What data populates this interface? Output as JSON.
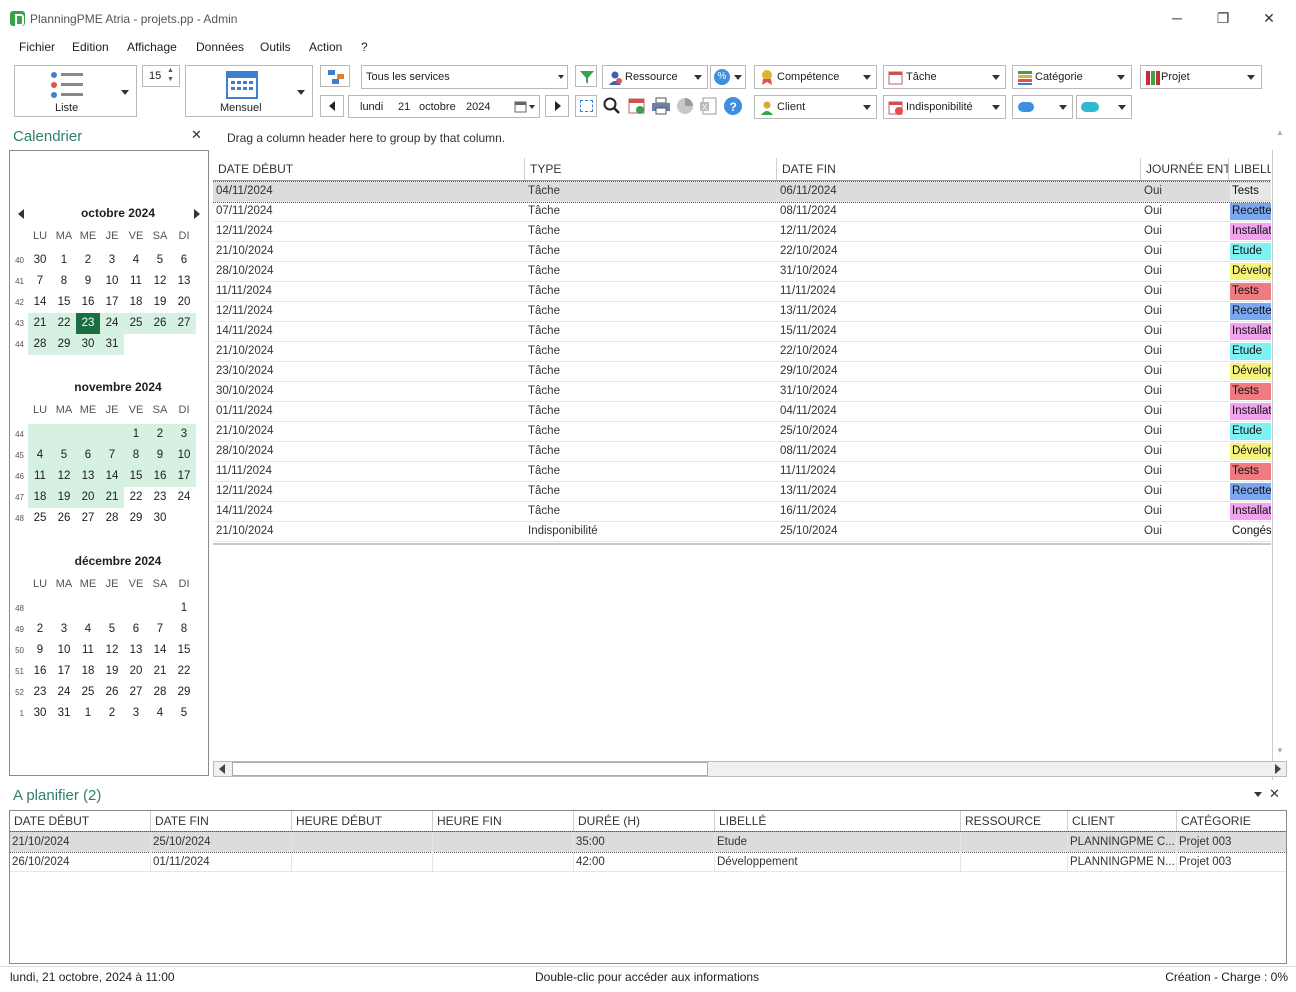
{
  "window": {
    "title": "PlanningPME Atria - projets.pp - Admin",
    "minimize": "─",
    "maximize": "❐",
    "close": "✕"
  },
  "menu": [
    "Fichier",
    "Edition",
    "Affichage",
    "Données",
    "Outils",
    "Action",
    "?"
  ],
  "toolbar": {
    "view_list_label": "Liste",
    "spin_value": "15",
    "view_month_label": "Mensuel",
    "services": "Tous les services",
    "date_day": "lundi",
    "date_num": "21",
    "date_month": "octobre",
    "date_year": "2024",
    "filters": {
      "ressource": "Ressource",
      "competence": "Compétence",
      "tache": "Tâche",
      "categorie": "Catégorie",
      "projet": "Projet",
      "client": "Client",
      "indisponibilite": "Indisponibilité"
    }
  },
  "calendar": {
    "title": "Calendrier",
    "close": "✕",
    "dow": [
      "LU",
      "MA",
      "ME",
      "JE",
      "VE",
      "SA",
      "DI"
    ],
    "months": [
      {
        "name": "octobre 2024",
        "weeks": [
          {
            "wk": "40",
            "days": [
              "30",
              "1",
              "2",
              "3",
              "4",
              "5",
              "6"
            ],
            "cls": [
              "",
              "",
              "",
              "",
              "",
              "",
              ""
            ]
          },
          {
            "wk": "41",
            "days": [
              "7",
              "8",
              "9",
              "10",
              "11",
              "12",
              "13"
            ],
            "cls": [
              "",
              "",
              "",
              "",
              "",
              "",
              ""
            ]
          },
          {
            "wk": "42",
            "days": [
              "14",
              "15",
              "16",
              "17",
              "18",
              "19",
              "20"
            ],
            "cls": [
              "",
              "",
              "",
              "",
              "",
              "",
              ""
            ]
          },
          {
            "wk": "43",
            "days": [
              "21",
              "22",
              "23",
              "24",
              "25",
              "26",
              "27"
            ],
            "cls": [
              "g",
              "g",
              "sel",
              "g",
              "g",
              "g",
              "g"
            ]
          },
          {
            "wk": "44",
            "days": [
              "28",
              "29",
              "30",
              "31",
              "",
              "",
              ""
            ],
            "cls": [
              "g",
              "g",
              "g",
              "g",
              "",
              "",
              ""
            ]
          }
        ]
      },
      {
        "name": "novembre 2024",
        "weeks": [
          {
            "wk": "44",
            "days": [
              "",
              "",
              "",
              "",
              "1",
              "2",
              "3"
            ],
            "cls": [
              "g",
              "g",
              "g",
              "g",
              "g",
              "g",
              "g"
            ]
          },
          {
            "wk": "45",
            "days": [
              "4",
              "5",
              "6",
              "7",
              "8",
              "9",
              "10"
            ],
            "cls": [
              "g",
              "g",
              "g",
              "g",
              "g",
              "g",
              "g"
            ]
          },
          {
            "wk": "46",
            "days": [
              "11",
              "12",
              "13",
              "14",
              "15",
              "16",
              "17"
            ],
            "cls": [
              "g",
              "g",
              "g",
              "g",
              "g",
              "g",
              "g"
            ]
          },
          {
            "wk": "47",
            "days": [
              "18",
              "19",
              "20",
              "21",
              "22",
              "23",
              "24"
            ],
            "cls": [
              "g",
              "g",
              "g",
              "g",
              "",
              "",
              ""
            ]
          },
          {
            "wk": "48",
            "days": [
              "25",
              "26",
              "27",
              "28",
              "29",
              "30",
              ""
            ],
            "cls": [
              "",
              "",
              "",
              "",
              "",
              "",
              ""
            ]
          }
        ]
      },
      {
        "name": "décembre 2024",
        "weeks": [
          {
            "wk": "48",
            "days": [
              "",
              "",
              "",
              "",
              "",
              "",
              "1"
            ],
            "cls": [
              "",
              "",
              "",
              "",
              "",
              "",
              ""
            ]
          },
          {
            "wk": "49",
            "days": [
              "2",
              "3",
              "4",
              "5",
              "6",
              "7",
              "8"
            ],
            "cls": [
              "",
              "",
              "",
              "",
              "",
              "",
              ""
            ]
          },
          {
            "wk": "50",
            "days": [
              "9",
              "10",
              "11",
              "12",
              "13",
              "14",
              "15"
            ],
            "cls": [
              "",
              "",
              "",
              "",
              "",
              "",
              ""
            ]
          },
          {
            "wk": "51",
            "days": [
              "16",
              "17",
              "18",
              "19",
              "20",
              "21",
              "22"
            ],
            "cls": [
              "",
              "",
              "",
              "",
              "",
              "",
              ""
            ]
          },
          {
            "wk": "52",
            "days": [
              "23",
              "24",
              "25",
              "26",
              "27",
              "28",
              "29"
            ],
            "cls": [
              "",
              "",
              "",
              "",
              "",
              "",
              ""
            ]
          },
          {
            "wk": "1",
            "days": [
              "30",
              "31",
              "1",
              "2",
              "3",
              "4",
              "5"
            ],
            "cls": [
              "",
              "",
              "",
              "",
              "",
              "",
              ""
            ]
          }
        ]
      }
    ]
  },
  "grid": {
    "group_hint": "Drag a column header here to group by that column.",
    "columns": [
      "DATE DÉBUT",
      "TYPE",
      "DATE FIN",
      "JOURNÉE ENT...",
      "LIBELLÉ"
    ],
    "rows": [
      {
        "start": "04/11/2024",
        "type": "Tâche",
        "end": "06/11/2024",
        "day": "Oui",
        "label": "Tests",
        "color": "#e8e8e8"
      },
      {
        "start": "07/11/2024",
        "type": "Tâche",
        "end": "08/11/2024",
        "day": "Oui",
        "label": "Recette",
        "color": "#7aa7ef"
      },
      {
        "start": "12/11/2024",
        "type": "Tâche",
        "end": "12/11/2024",
        "day": "Oui",
        "label": "Installat",
        "color": "#f3a2f0"
      },
      {
        "start": "21/10/2024",
        "type": "Tâche",
        "end": "22/10/2024",
        "day": "Oui",
        "label": "Etude",
        "color": "#7ef2f2"
      },
      {
        "start": "28/10/2024",
        "type": "Tâche",
        "end": "31/10/2024",
        "day": "Oui",
        "label": "Dévelop",
        "color": "#f6f37a"
      },
      {
        "start": "11/11/2024",
        "type": "Tâche",
        "end": "11/11/2024",
        "day": "Oui",
        "label": "Tests",
        "color": "#f07a80"
      },
      {
        "start": "12/11/2024",
        "type": "Tâche",
        "end": "13/11/2024",
        "day": "Oui",
        "label": "Recette",
        "color": "#7aa7ef"
      },
      {
        "start": "14/11/2024",
        "type": "Tâche",
        "end": "15/11/2024",
        "day": "Oui",
        "label": "Installat",
        "color": "#f3a2f0"
      },
      {
        "start": "21/10/2024",
        "type": "Tâche",
        "end": "22/10/2024",
        "day": "Oui",
        "label": "Etude",
        "color": "#7ef2f2"
      },
      {
        "start": "23/10/2024",
        "type": "Tâche",
        "end": "29/10/2024",
        "day": "Oui",
        "label": "Dévelop",
        "color": "#f6f37a"
      },
      {
        "start": "30/10/2024",
        "type": "Tâche",
        "end": "31/10/2024",
        "day": "Oui",
        "label": "Tests",
        "color": "#f07a80"
      },
      {
        "start": "01/11/2024",
        "type": "Tâche",
        "end": "04/11/2024",
        "day": "Oui",
        "label": "Installat",
        "color": "#f3a2f0"
      },
      {
        "start": "21/10/2024",
        "type": "Tâche",
        "end": "25/10/2024",
        "day": "Oui",
        "label": "Etude",
        "color": "#7ef2f2"
      },
      {
        "start": "28/10/2024",
        "type": "Tâche",
        "end": "08/11/2024",
        "day": "Oui",
        "label": "Dévelop",
        "color": "#f6f37a"
      },
      {
        "start": "11/11/2024",
        "type": "Tâche",
        "end": "11/11/2024",
        "day": "Oui",
        "label": "Tests",
        "color": "#f07a80"
      },
      {
        "start": "12/11/2024",
        "type": "Tâche",
        "end": "13/11/2024",
        "day": "Oui",
        "label": "Recette",
        "color": "#7aa7ef"
      },
      {
        "start": "14/11/2024",
        "type": "Tâche",
        "end": "16/11/2024",
        "day": "Oui",
        "label": "Installat",
        "color": "#f3a2f0"
      },
      {
        "start": "21/10/2024",
        "type": "Indisponibilité",
        "end": "25/10/2024",
        "day": "Oui",
        "label": "Congés",
        "color": "#ffffff"
      }
    ]
  },
  "planner": {
    "title": "A planifier (2)",
    "close": "✕",
    "columns": [
      "DATE DÉBUT",
      "DATE FIN",
      "HEURE DÉBUT",
      "HEURE FIN",
      "DURÉE (H)",
      "LIBELLÉ",
      "RESSOURCE",
      "CLIENT",
      "CATÉGORIE"
    ],
    "rows": [
      [
        "21/10/2024",
        "25/10/2024",
        "",
        "",
        "35:00",
        "Etude",
        "",
        "PLANNINGPME C...",
        "Projet 003"
      ],
      [
        "26/10/2024",
        "01/11/2024",
        "",
        "",
        "42:00",
        "Développement",
        "",
        "PLANNINGPME N...",
        "Projet 003"
      ]
    ]
  },
  "status": {
    "left": "lundi, 21 octobre, 2024 à 11:00",
    "center": "Double-clic pour accéder aux informations",
    "right": "Création - Charge : 0%"
  }
}
